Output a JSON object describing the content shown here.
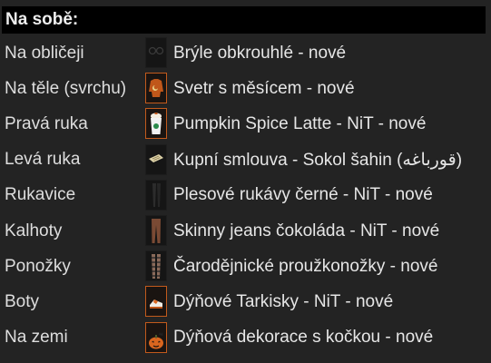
{
  "header": {
    "title": "Na sobě:"
  },
  "rows": [
    {
      "slot": "Na obličeji",
      "item": "Brýle obkrouhlé - nové",
      "icon": "glasses-icon"
    },
    {
      "slot": "Na těle (svrchu)",
      "item": "Svetr s měsícem - nové",
      "icon": "sweater-icon"
    },
    {
      "slot": "Pravá ruka",
      "item": "Pumpkin Spice Latte - NiT - nové",
      "icon": "latte-cup-icon"
    },
    {
      "slot": "Levá ruka",
      "item": "Kupní smlouva - Sokol šahin (قورباغه)",
      "icon": "document-scroll-icon"
    },
    {
      "slot": "Rukavice",
      "item": "Plesové rukávy černé - NiT - nové",
      "icon": "black-sleeves-icon"
    },
    {
      "slot": "Kalhoty",
      "item": "Skinny jeans čokoláda - NiT - nové",
      "icon": "jeans-icon"
    },
    {
      "slot": "Ponožky",
      "item": "Čarodějnické proužkonožky - nové",
      "icon": "striped-stockings-icon"
    },
    {
      "slot": "Boty",
      "item": "Dýňové Tarkisky - NiT - nové",
      "icon": "sneakers-icon"
    },
    {
      "slot": "Na zemi",
      "item": "Dýňová dekorace s kočkou - nové",
      "icon": "pumpkin-cat-icon"
    }
  ],
  "colors": {
    "background": "#232323",
    "header_bg": "#000000",
    "icon_highlight_border": "#c25a1c"
  }
}
